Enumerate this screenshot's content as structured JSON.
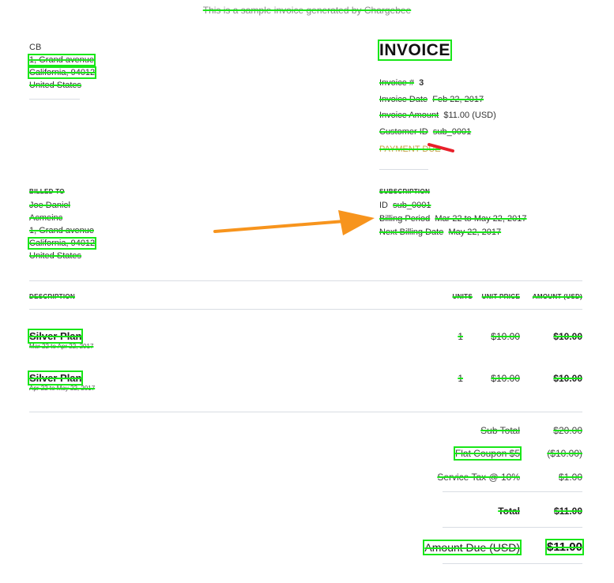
{
  "top_note": "This is a sample invoice generated by Chargebee",
  "seller": {
    "name": "CB",
    "street": "1, Grand avenue",
    "city": "California, 94012",
    "country": "United States"
  },
  "invoice": {
    "title": "INVOICE",
    "number_label": "Invoice #",
    "number": "3",
    "date_label": "Invoice Date",
    "date": "Feb 22, 2017",
    "amount_label": "Invoice Amount",
    "amount": "$11.00 (USD)",
    "customer_label": "Customer ID",
    "customer_id": "sub_0001",
    "status": "PAYMENT DUE"
  },
  "billed_to": {
    "heading": "BILLED TO",
    "name": "Joe Daniel",
    "company": "Acmeinc",
    "street": "1, Grand avenue",
    "city": "California, 94012",
    "country": "United States"
  },
  "subscription": {
    "heading": "SUBSCRIPTION",
    "id_label": "ID",
    "id": "sub_0001",
    "period_label": "Billing Period",
    "period": "Mar 22 to May 22, 2017",
    "next_label": "Next Billing Date",
    "next": "May 22, 2017"
  },
  "table": {
    "headers": {
      "description": "DESCRIPTION",
      "units": "UNITS",
      "unit_price": "UNIT PRICE",
      "amount": "AMOUNT (USD)"
    },
    "rows": [
      {
        "title": "Silver Plan",
        "period": "Mar 22 to Apr 22, 2017",
        "units": "1",
        "unit_price": "$10.00",
        "amount": "$10.00"
      },
      {
        "title": "Silver Plan",
        "period": "Apr 22 to May 22, 2017",
        "units": "1",
        "unit_price": "$10.00",
        "amount": "$10.00"
      }
    ]
  },
  "summary": {
    "subtotal_label": "Sub Total",
    "subtotal": "$20.00",
    "coupon_label": "Flat Coupon $5",
    "coupon": "($10.00)",
    "tax_label": "Service Tax @ 10%",
    "tax": "$1.00",
    "total_label": "Total",
    "total": "$11.00",
    "due_label": "Amount Due (USD)",
    "due": "$11.00"
  },
  "colors": {
    "highlight": "#19e619",
    "arrow": "#f7941d",
    "status": "#c9a34a",
    "red_mark": "#e8202a"
  }
}
